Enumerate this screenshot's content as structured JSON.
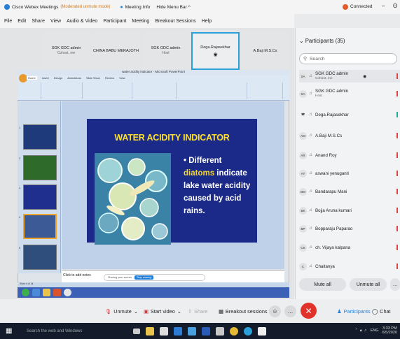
{
  "window": {
    "app_title": "Cisco Webex Meetings",
    "moderated_note": "(Moderated unmute mode)",
    "meeting_info": "Meeting Info",
    "hide_menu_bar": "Hide Menu Bar ^",
    "connected": "Connected",
    "minimize": "–",
    "close": "ʘ"
  },
  "menu": [
    "File",
    "Edit",
    "Share",
    "View",
    "Audio & Video",
    "Participant",
    "Meeting",
    "Breakout Sessions",
    "Help"
  ],
  "video_strip": [
    {
      "name": "SGK GDC admin",
      "sub": "Cohost, me"
    },
    {
      "name": "CHINA BABU MERAJOTH",
      "sub": ""
    },
    {
      "name": "SGK GDC admin",
      "sub": "Host"
    },
    {
      "name": "Dega.Rajasekhar",
      "sub": ""
    },
    {
      "name": "A.Baji M.S.Cs",
      "sub": ""
    }
  ],
  "powerpoint": {
    "title": "water acidity indicator - Microsoft PowerPoint",
    "tabs": [
      "Home",
      "Insert",
      "Design",
      "Animations",
      "Slide Show",
      "Review",
      "View"
    ],
    "slide_numbers": [
      "1",
      "2",
      "3",
      "4",
      "5"
    ],
    "notes": "Click to add notes",
    "status": "Slide 4 of 14",
    "share_notice": "Sharing your screen",
    "stop_sharing": "Stop sharing"
  },
  "slide": {
    "title": "WATER ACIDITY INDICATOR",
    "bullet_prefix": "• Different ",
    "bullet_highlight": "diatoms",
    "bullet_rest": "indicate lake water acidity caused by acid rains."
  },
  "controls": {
    "unmute": "Unmute",
    "start_video": "Start video",
    "share": "Share",
    "breakout": "Breakout sessions",
    "more": "…",
    "participants": "Participants",
    "chat": "Chat"
  },
  "panel": {
    "header": "Participants (35)",
    "search_placeholder": "Search",
    "participants": [
      {
        "initials": "SA",
        "name": "SGK GDC admin",
        "role": "Cohost, me"
      },
      {
        "initials": "SA",
        "name": "SGK GDC admin",
        "role": "Host"
      },
      {
        "initials": "",
        "name": "Dega.Rajasekhar",
        "role": ""
      },
      {
        "initials": "AM",
        "name": "A.Baji M.S.Cs",
        "role": ""
      },
      {
        "initials": "AR",
        "name": "Anand Roy",
        "role": ""
      },
      {
        "initials": "AY",
        "name": "aswani yenuganti",
        "role": ""
      },
      {
        "initials": "BM",
        "name": "Bandarapu Mani",
        "role": ""
      },
      {
        "initials": "BK",
        "name": "Bojja Aruna kumari",
        "role": ""
      },
      {
        "initials": "BP",
        "name": "Bopparaju Paparao",
        "role": ""
      },
      {
        "initials": "CK",
        "name": "ch. Vijaya kalpana",
        "role": ""
      },
      {
        "initials": "C",
        "name": "Chaitanya",
        "role": ""
      }
    ],
    "mute_all": "Mute all",
    "unmute_all": "Unmute all"
  },
  "taskbar": {
    "search": "Search the web and Windows",
    "lang": "ENG",
    "time": "3:33 PM",
    "date": "6/5/2020"
  },
  "colors": {
    "accent": "#2aa0d8",
    "leave": "#e0322b",
    "slide_bg": "#1b2a88",
    "slide_title": "#fde02c"
  }
}
